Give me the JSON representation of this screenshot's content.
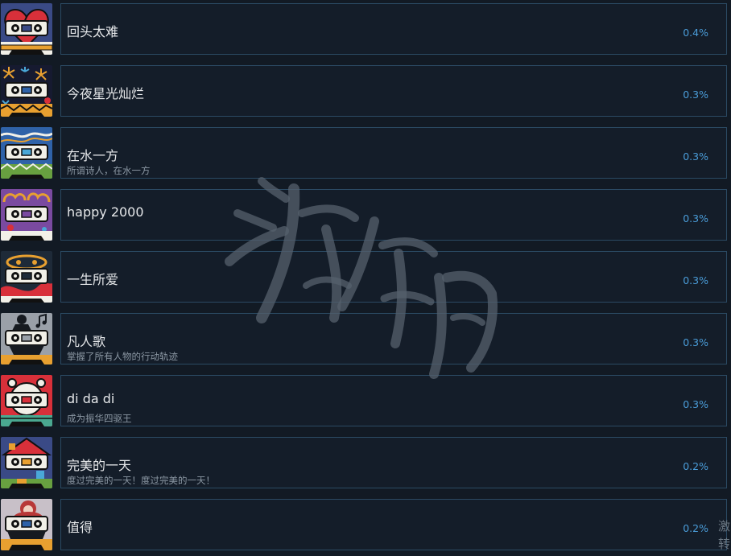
{
  "achievements": [
    {
      "title": "回头太难",
      "description": "",
      "percent": "0.4%",
      "icon": "broken-heart-cassette-icon",
      "colors": {
        "bg": "#3a4a86",
        "accent": "#d8303a",
        "tape": "#f2f0e8",
        "stripe": "#e8a030"
      }
    },
    {
      "title": "今夜星光灿烂",
      "description": "",
      "percent": "0.3%",
      "icon": "fireworks-cassette-icon",
      "colors": {
        "bg": "#161a30",
        "accent": "#e8a030",
        "tape": "#f2f0e8",
        "stripe": "#f2f0e8"
      }
    },
    {
      "title": "在水一方",
      "description": "所谓诗人，在水一方",
      "percent": "0.3%",
      "icon": "river-cassette-icon",
      "colors": {
        "bg": "#2f62a8",
        "accent": "#f2f0e8",
        "tape": "#f2f0e8",
        "stripe": "#68a040"
      }
    },
    {
      "title": "happy 2000",
      "description": "",
      "percent": "0.3%",
      "icon": "party-2000-cassette-icon",
      "colors": {
        "bg": "#7a4aa0",
        "accent": "#e8a030",
        "tape": "#f2f0e8",
        "stripe": "#f2f0e8"
      }
    },
    {
      "title": "一生所爱",
      "description": "",
      "percent": "0.3%",
      "icon": "lifelong-love-cassette-icon",
      "colors": {
        "bg": "#1e2a38",
        "accent": "#d8303a",
        "tape": "#f2f0e8",
        "stripe": "#f2f0e8"
      }
    },
    {
      "title": "凡人歌",
      "description": "掌握了所有人物的行动轨迹",
      "percent": "0.3%",
      "icon": "singer-cassette-icon",
      "colors": {
        "bg": "#9aa0a8",
        "accent": "#161a20",
        "tape": "#f2f0e8",
        "stripe": "#e8a030"
      }
    },
    {
      "title": "di da di",
      "description": "成为振华四驱王",
      "percent": "0.3%",
      "icon": "clock-cassette-icon",
      "colors": {
        "bg": "#d8303a",
        "accent": "#f2f0e8",
        "tape": "#f2f0e8",
        "stripe": "#4aa890"
      }
    },
    {
      "title": "完美的一天",
      "description": "度过完美的一天！度过完美的一天！",
      "percent": "0.2%",
      "icon": "perfect-day-cassette-icon",
      "colors": {
        "bg": "#3a4a86",
        "accent": "#e8a030",
        "tape": "#f2f0e8",
        "stripe": "#68a040"
      }
    },
    {
      "title": "值得",
      "description": "",
      "percent": "0.2%",
      "icon": "worth-it-cassette-icon",
      "colors": {
        "bg": "#c8c0c8",
        "accent": "#b83838",
        "tape": "#f2f0e8",
        "stripe": "#e8a030"
      }
    }
  ],
  "corner_text": "激转",
  "colors": {
    "page_bg": "#121a24",
    "card_bg": "#141d29",
    "card_border": "#2b4a63",
    "title": "#e6e8ea",
    "description": "#8c98a4",
    "percent": "#4a9cd8",
    "watermark": "#55606c"
  }
}
